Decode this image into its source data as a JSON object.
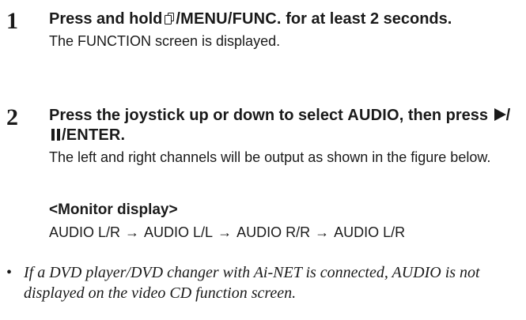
{
  "steps": [
    {
      "number": "1",
      "instruction_part1": "Press and hold",
      "menu_button": "/MENU/FUNC.",
      "instruction_part2": "for at least 2 seconds.",
      "description": "The FUNCTION screen is displayed."
    },
    {
      "number": "2",
      "instruction_part1": "Press the",
      "joystick": "joystick",
      "instruction_part2": "up or down to select",
      "audio": "AUDIO",
      "instruction_part3": ", then press",
      "enter": "/ENTER",
      "instruction_part4": ".",
      "description": "The left and right channels will be output as shown in the figure below."
    }
  ],
  "monitor_display": {
    "label": "<Monitor display>",
    "sequence": [
      "AUDIO L/R",
      "AUDIO L/L",
      "AUDIO R/R",
      "AUDIO L/R"
    ],
    "arrow": "→"
  },
  "note": {
    "bullet": "•",
    "text": "If a DVD player/DVD changer with Ai-NET is connected, AUDIO is not displayed on the video CD function screen."
  }
}
